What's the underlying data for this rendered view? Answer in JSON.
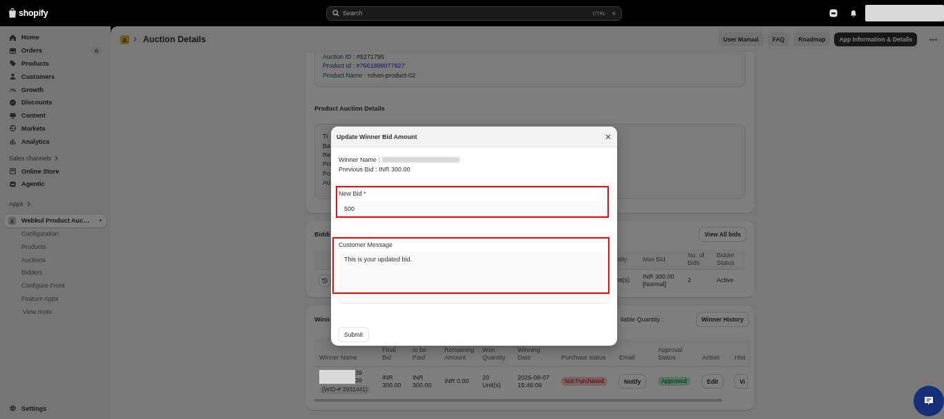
{
  "topbar": {
    "logo": "shopify",
    "search": {
      "placeholder": "Search",
      "shortcut": [
        "CTRL",
        "K"
      ]
    }
  },
  "sidebar": {
    "groups": [
      {
        "items": [
          {
            "label": "Home",
            "selected": false
          },
          {
            "label": "Orders",
            "badge": "6",
            "selected": false
          },
          {
            "label": "Products",
            "selected": false
          },
          {
            "label": "Customers",
            "selected": false
          },
          {
            "label": "Growth",
            "selected": false
          },
          {
            "label": "Discounts",
            "selected": false
          },
          {
            "label": "Content",
            "selected": false
          },
          {
            "label": "Markets",
            "selected": false
          },
          {
            "label": "Analytics",
            "selected": false
          }
        ]
      },
      {
        "heading": "Sales channels",
        "items": [
          {
            "label": "Online Store",
            "selected": false
          },
          {
            "label": "Agentic",
            "selected": false
          }
        ]
      },
      {
        "heading": "Apps",
        "items": [
          {
            "label": "Webkul Product Auc…",
            "indicator": "•",
            "selected": true,
            "children": [
              {
                "label": "Configuration",
                "selected": false
              },
              {
                "label": "Products",
                "selected": false
              },
              {
                "label": "Auctions",
                "selected": false
              },
              {
                "label": "Bidders",
                "selected": false
              },
              {
                "label": "Configure Front",
                "selected": false
              },
              {
                "label": "Feature Apps",
                "selected": false
              }
            ],
            "more": "View more"
          }
        ]
      }
    ],
    "settings": {
      "label": "Settings",
      "selected": false
    }
  },
  "header": {
    "title": "Auction Details",
    "buttons": [
      {
        "label": "User Manual",
        "kind": "secondary"
      },
      {
        "label": "FAQ",
        "kind": "secondary"
      },
      {
        "label": "Roadmap",
        "kind": "secondary"
      },
      {
        "label": "App Information & Details",
        "kind": "primary"
      }
    ]
  },
  "product_info": {
    "lines": [
      {
        "label": "Auction ID : ",
        "value": "#5271795",
        "kind": "text"
      },
      {
        "label": "Product Id : #",
        "value": "7661888077927",
        "kind": "link"
      },
      {
        "label": "Product Name : ",
        "value": "rohan-product-02",
        "kind": "text"
      }
    ]
  },
  "auction_details": {
    "title": "Product Auction Details",
    "fragments": [
      "Ti",
      "Ba",
      "Re",
      "Pro",
      "Po",
      "Au"
    ]
  },
  "bidding": {
    "title": "Biddi",
    "button": "View All bids",
    "columns": [
      "ntity",
      "Max Bid",
      "No. of Bids",
      "Bidder Status"
    ],
    "rows": [
      {
        "cells": [
          "nit(s)",
          "INR 300.00 [Normal]",
          "2",
          "Active"
        ]
      }
    ]
  },
  "winner": {
    "title": "Winn",
    "quantity_label": "ilable Quantity :",
    "button": "Winner History",
    "columns": [
      "Winner Name",
      "Final Bid",
      "to be Paid",
      "Remaining Amount",
      "Won Quantity",
      "Winning Date",
      "Purchase status",
      "Email",
      "Approval Status",
      "Action",
      "Hist"
    ],
    "rows": [
      {
        "cells": [
          {
            "kind": "name",
            "lines": [
              "39",
              "39"
            ],
            "wid": "(WID-# 3931441)"
          },
          {
            "kind": "text",
            "text": "INR 300.00"
          },
          {
            "kind": "text",
            "text": "INR 300.00"
          },
          {
            "kind": "text",
            "text": "INR 0.00"
          },
          {
            "kind": "text",
            "text": "20 Unit(s)"
          },
          {
            "kind": "text",
            "text": "2026-08-07 15:46:09"
          },
          {
            "kind": "badge",
            "text": "Not Purchased",
            "color": "#7e6262"
          },
          {
            "kind": "button",
            "text": "Notify"
          },
          {
            "kind": "badge",
            "text": "Approved",
            "color": "#57775f"
          },
          {
            "kind": "button",
            "text": "Edit"
          },
          {
            "kind": "button",
            "text": "Vi"
          }
        ]
      }
    ]
  },
  "modal": {
    "title": "Update Winner Bid Amount",
    "winner_label": "Winner Name :",
    "previous_bid": "Previous Bid : INR 300.00",
    "fields": [
      {
        "kind": "input",
        "label": "New Bid",
        "required_mark": "*",
        "value": "500",
        "highlighted": true
      },
      {
        "kind": "textarea",
        "label": "Customer Message",
        "value": "This is your updated bid.",
        "highlighted": true
      }
    ],
    "submit": "Submit"
  }
}
